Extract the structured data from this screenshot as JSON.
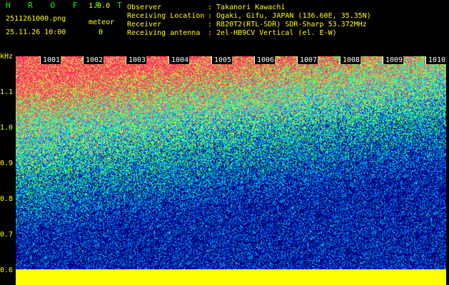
{
  "header": {
    "app_name": "H R O F F T",
    "version": "1.0.0",
    "filename": "2511261000.png",
    "datetime": "25.11.26 10:00",
    "meteor_label": "meteor",
    "meteor_count": "0",
    "fields": [
      {
        "label": "Observer",
        "value": ": Takanori Kawachi"
      },
      {
        "label": "Receiving Location",
        "value": ": Ogaki, Gifu, JAPAN (136.60E, 35.35N)"
      },
      {
        "label": "Receiver",
        "value": ": R820T2(RTL-SDR) SDR-Sharp 53.372MHz"
      },
      {
        "label": "Receiving antenna",
        "value": ": 2el-HB9CV Vertical (el. E-W)"
      }
    ]
  },
  "plot": {
    "y_axis_unit": "kHz",
    "y_ticks": [
      "1.1",
      "1.0",
      "0.9",
      "0.8",
      "0.7",
      "0.6"
    ],
    "time_ticks": [
      "1001",
      "1002",
      "1003",
      "1004",
      "1005",
      "1006",
      "1007",
      "1008",
      "1009",
      "1010"
    ],
    "colors": {
      "noise_floor": "#ffff00",
      "strong": "#ff2050",
      "medium_green": "#40ff40",
      "weak_blue": "#0030ff",
      "cyan": "#00e0ff"
    }
  }
}
